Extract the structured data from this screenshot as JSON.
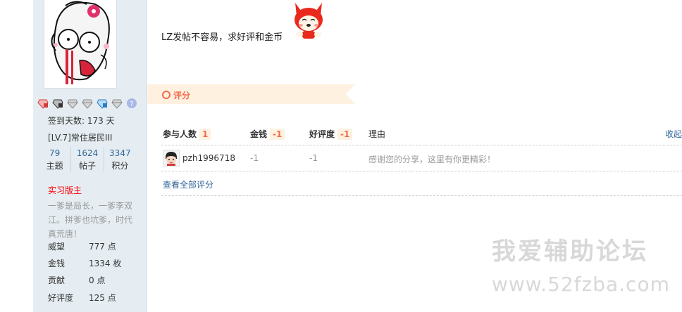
{
  "profile": {
    "checkin": "签到天数: 173 天",
    "level": "[LV.7]常住居民III",
    "topics_num": "79",
    "topics_label": "主题",
    "posts_num": "1624",
    "posts_label": "帖子",
    "points_num": "3347",
    "points_label": "积分",
    "group": "实习版主",
    "signature": "一爹是局长，一爹李双江。拼爹也坑爹，时代真荒唐！",
    "stats": [
      {
        "k": "威望",
        "v": "777 点"
      },
      {
        "k": "金钱",
        "v": "1334 枚"
      },
      {
        "k": "贡献",
        "v": "0 点"
      },
      {
        "k": "好评度",
        "v": "125 点"
      }
    ]
  },
  "post": {
    "text": "LZ发帖不容易，求好评和金币"
  },
  "rating": {
    "title": "评分",
    "participants_label": "参与人数",
    "participants_count": "1",
    "money_label": "金钱",
    "money_total": "-1",
    "reputation_label": "好评度",
    "reputation_total": "-1",
    "reason_label": "理由",
    "collapse_label": "收起",
    "rows": [
      {
        "user": "pzh1996718",
        "money": "-1",
        "reputation": "-1",
        "reason": "感谢您的分享，这里有你更精彩！"
      }
    ],
    "view_all": "查看全部评分"
  },
  "watermark": {
    "line1": "我爱辅助论坛",
    "line2": "www.52fzba.com"
  },
  "colors": {
    "sidebar_bg": "#e5edf2",
    "accent": "#f26c4f",
    "link": "#336699",
    "band": "#fff1e0"
  }
}
